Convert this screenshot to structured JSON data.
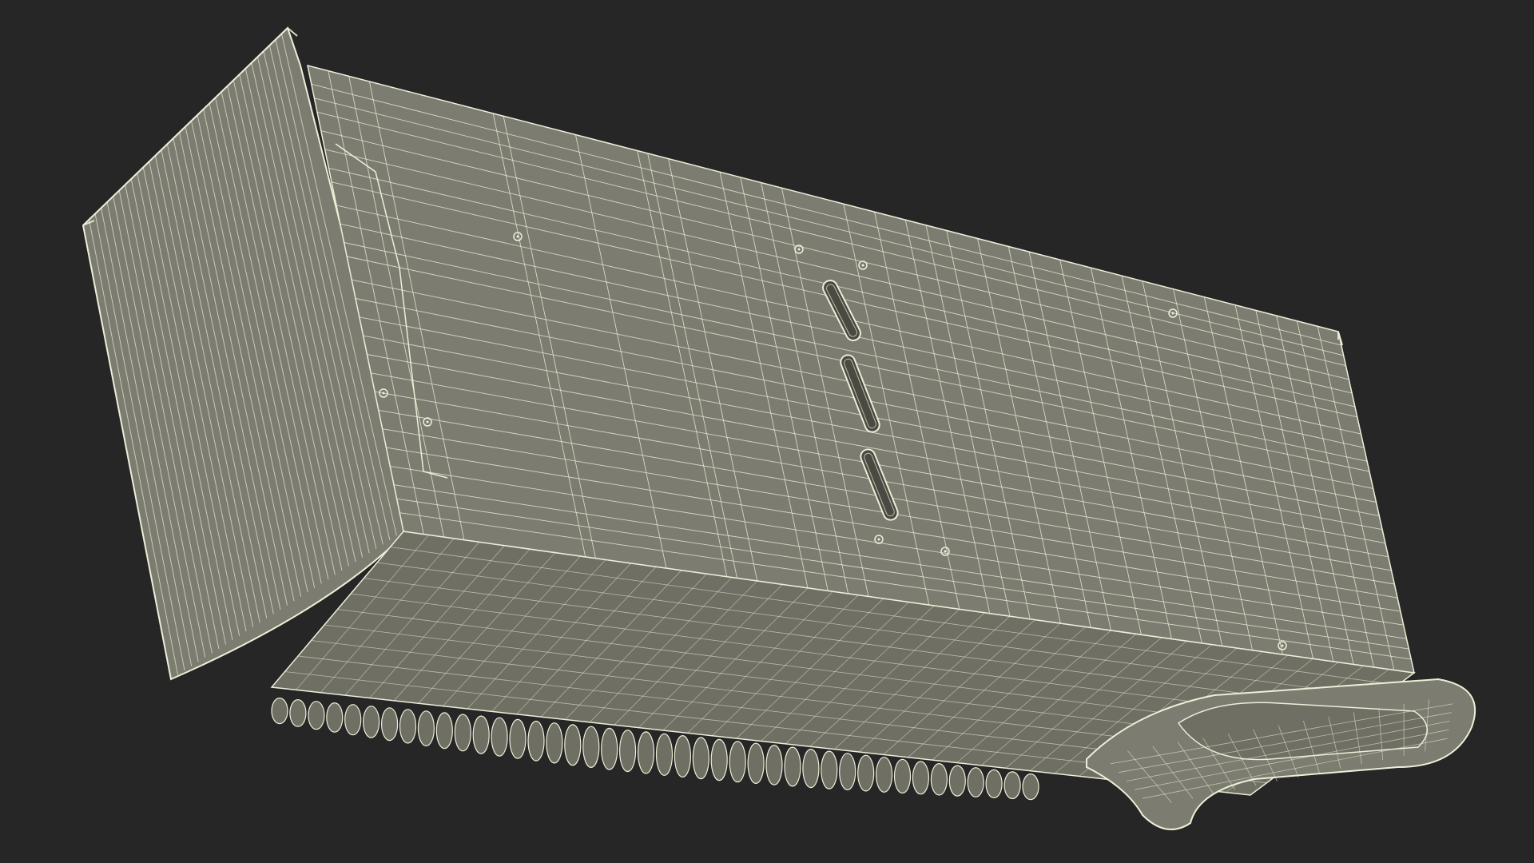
{
  "scene": {
    "background": "#262626",
    "surface_color": "#7c7c70",
    "surface_shade": "#6f6f64",
    "wire_color": "#ecefd8",
    "slot_color": "#4a4a42"
  }
}
